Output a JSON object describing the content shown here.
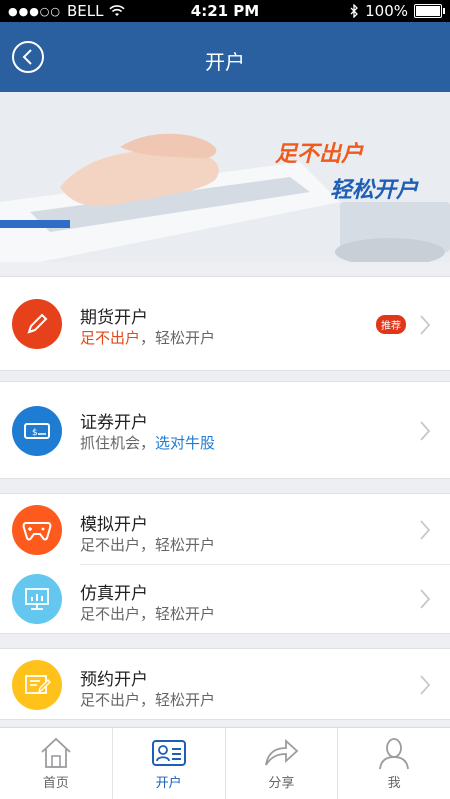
{
  "status_bar": {
    "signal": "●●●○○",
    "carrier": "BELL",
    "time": "4:21 PM",
    "battery": "100%",
    "battery_fraction": 1.0
  },
  "nav": {
    "title": "开户",
    "back_icon": "chevron-left-icon"
  },
  "banner": {
    "slogan_line1": "足不出户",
    "slogan_line2": "轻松开户"
  },
  "items": [
    {
      "title": "期货开户",
      "subtitle_highlight": "足不出户",
      "subtitle_rest": "，轻松开户",
      "badge": "推荐",
      "icon": "pencil-icon",
      "color": "#e6411a"
    },
    {
      "title": "证券开户",
      "subtitle_plain": "抓住机会，",
      "subtitle_highlight": "选对牛股",
      "icon": "banknote-icon",
      "color": "#1e7dd3"
    },
    {
      "title": "模拟开户",
      "subtitle": "足不出户，轻松开户",
      "icon": "gamepad-icon",
      "color": "#ff5a1e"
    },
    {
      "title": "仿真开户",
      "subtitle": "足不出户，轻松开户",
      "icon": "monitor-chart-icon",
      "color": "#63c7f0"
    },
    {
      "title": "预约开户",
      "subtitle": "足不出户，轻松开户",
      "icon": "note-edit-icon",
      "color": "#ffc21a"
    }
  ],
  "tabs": [
    {
      "label": "首页",
      "icon": "home-icon",
      "active": false
    },
    {
      "label": "开户",
      "icon": "account-card-icon",
      "active": true
    },
    {
      "label": "分享",
      "icon": "share-icon",
      "active": false
    },
    {
      "label": "我",
      "icon": "user-icon",
      "active": false
    }
  ],
  "colors": {
    "nav_bg": "#2a5fa0",
    "accent_blue": "#1e5fb5",
    "accent_red": "#e04a1c"
  }
}
